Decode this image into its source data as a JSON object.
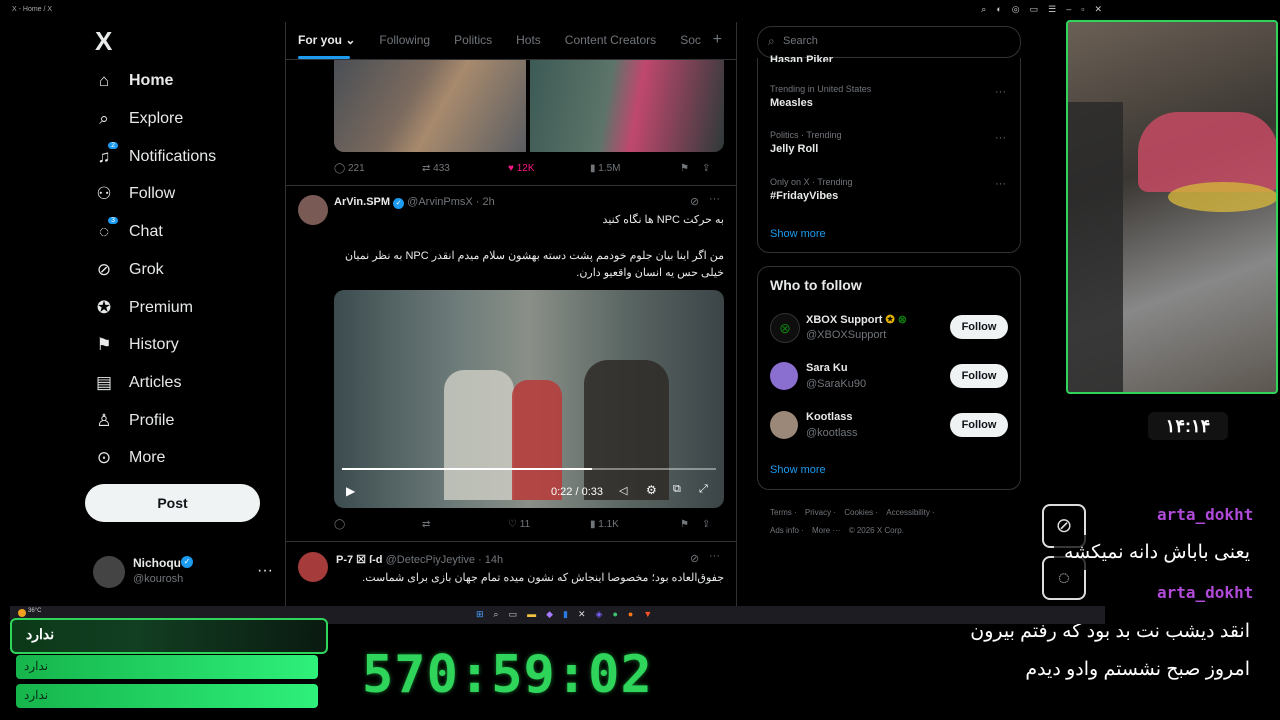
{
  "browser": {
    "title": "X - Home / X",
    "controls": [
      "⌕",
      "◐",
      "◎",
      "▭",
      "☰",
      "–",
      "▫",
      "✕"
    ]
  },
  "nav": {
    "logo": "X",
    "items": [
      {
        "label": "Home",
        "icon": "home-icon"
      },
      {
        "label": "Explore",
        "icon": "search-icon"
      },
      {
        "label": "Notifications",
        "icon": "bell-icon",
        "badge": "2"
      },
      {
        "label": "Follow",
        "icon": "add-person-icon"
      },
      {
        "label": "Chat",
        "icon": "chat-icon",
        "badge": "3"
      },
      {
        "label": "Grok",
        "icon": "grok-icon"
      },
      {
        "label": "Premium",
        "icon": "verified-icon"
      },
      {
        "label": "History",
        "icon": "bookmark-icon"
      },
      {
        "label": "Articles",
        "icon": "article-icon"
      },
      {
        "label": "Profile",
        "icon": "person-icon"
      },
      {
        "label": "More",
        "icon": "more-circle-icon"
      }
    ],
    "post_label": "Post",
    "account": {
      "name": "Nichoqu",
      "handle": "@kourosh"
    }
  },
  "feed": {
    "tabs": [
      "For you",
      "Following",
      "Politics",
      "Hots",
      "Content Creators",
      "Soc"
    ],
    "post1_stats": {
      "replies": "221",
      "reposts": "433",
      "likes": "12K",
      "views": "1.5M"
    },
    "post2": {
      "name": "ArVin.SPM",
      "handle": "@ArvinPmsX",
      "time": "· 2h",
      "line1": "به حرکت NPC ها نگاه کنید",
      "line2": "من اگر اینا بیان جلوم خودمم پشت دسته بهشون سلام میدم انقدر NPC به نظر نمیان",
      "line3": "خیلی حس یه انسان واقعیو دارن.",
      "video_time": "0:22 / 0:33",
      "stats": {
        "reposts": "",
        "likes": "11",
        "views": "1.1K"
      }
    },
    "post3": {
      "name": "P-7 ☒ ſ-d",
      "handle": "@DetecPiyJeytive",
      "time": "· 14h",
      "text": "جفوق‌العاده بود؛ مخصوصا اینجاش که نشون میده تمام جهان بازی برای شماست."
    }
  },
  "right": {
    "search_placeholder": "Search",
    "trend_top_cut": "Hasan Piker",
    "trends": [
      {
        "context": "Trending in United States",
        "topic": "Measles"
      },
      {
        "context": "Politics · Trending",
        "topic": "Jelly Roll"
      },
      {
        "context": "Only on X · Trending",
        "topic": "#FridayVibes"
      }
    ],
    "show_more": "Show more",
    "who_to_follow": "Who to follow",
    "suggestions": [
      {
        "name": "XBOX Support",
        "handle": "@XBOXSupport",
        "color": "#107c10"
      },
      {
        "name": "Sara Ku",
        "handle": "@SaraKu90",
        "color": "#8a6fd1"
      },
      {
        "name": "Kootlass",
        "handle": "@kootlass",
        "color": "#9b8878"
      }
    ],
    "follow_label": "Follow",
    "show_more2": "Show more",
    "footer": [
      "Terms",
      "Privacy",
      "Cookies",
      "Accessibility",
      "Ads info",
      "More ···",
      "© 2026 X Corp."
    ]
  },
  "overlay": {
    "clock": "۱۴:۱۴",
    "chat": [
      {
        "user": "arta_dokht",
        "msg": "یعنی باباش دانه نمیکشه"
      },
      {
        "user": "arta_dokht",
        "msg1": "انقد دیشب نت بد بود که رفتم بیرون",
        "msg2": "امروز صبح نشستم وادو دیدم"
      }
    ],
    "goal": "ندارد",
    "goal2": "ندارد",
    "goal3": "ندارد",
    "timer": "570:59:02",
    "weather": "36°C",
    "accent": "#2fd45a"
  }
}
